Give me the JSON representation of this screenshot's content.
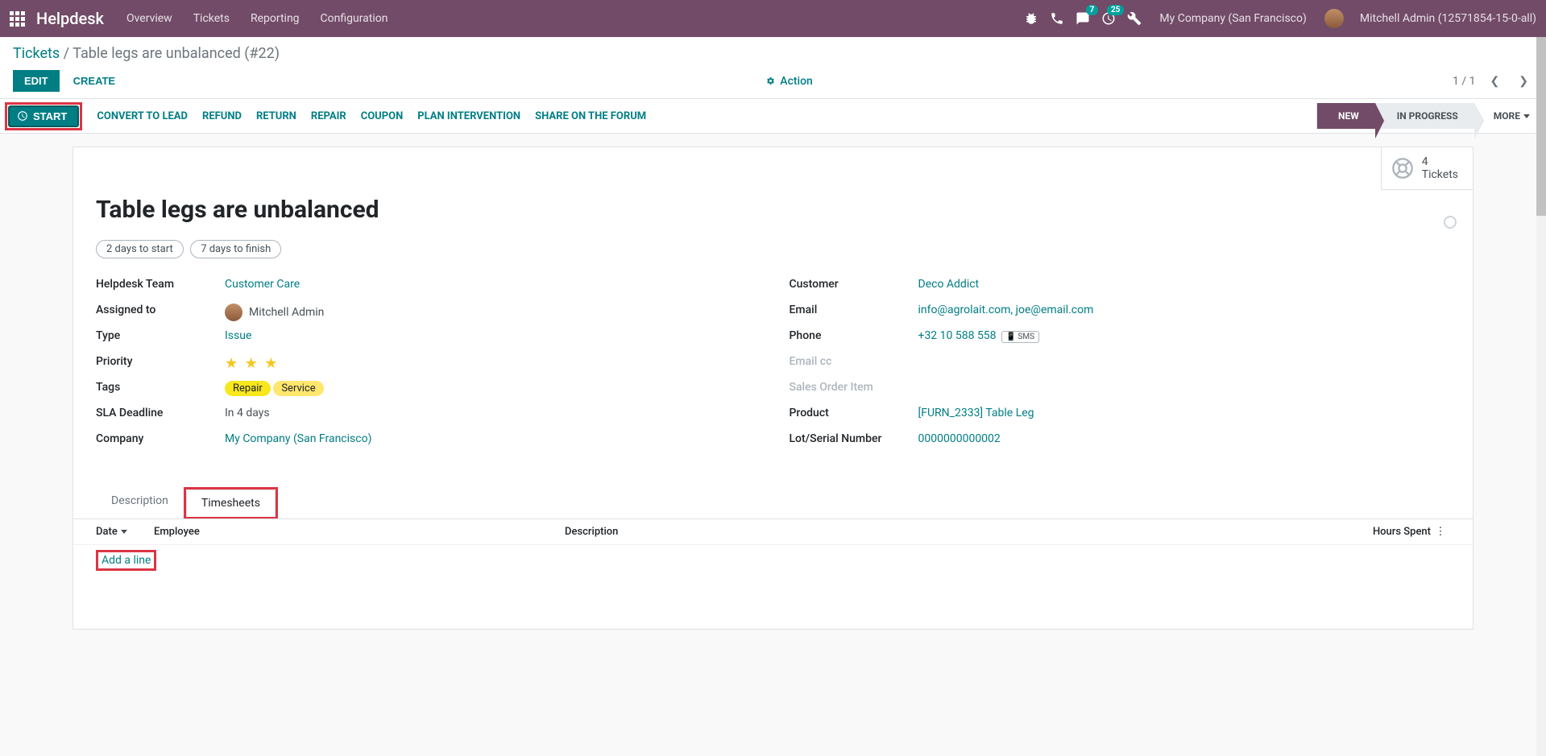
{
  "topbar": {
    "brand": "Helpdesk",
    "nav": [
      "Overview",
      "Tickets",
      "Reporting",
      "Configuration"
    ],
    "msg_badge": "7",
    "activity_badge": "25",
    "company": "My Company (San Francisco)",
    "user": "Mitchell Admin (12571854-15-0-all)"
  },
  "breadcrumb": {
    "root": "Tickets",
    "sep": " / ",
    "current": "Table legs are unbalanced (#22)"
  },
  "controls": {
    "edit": "EDIT",
    "create": "CREATE",
    "action": "Action",
    "pager": "1 / 1"
  },
  "statusbar": {
    "start": "START",
    "actions": [
      "CONVERT TO LEAD",
      "REFUND",
      "RETURN",
      "REPAIR",
      "COUPON",
      "PLAN INTERVENTION",
      "SHARE ON THE FORUM"
    ],
    "stages": {
      "new": "NEW",
      "in_progress": "IN PROGRESS",
      "more": "MORE"
    }
  },
  "stat": {
    "count": "4",
    "label": "Tickets"
  },
  "record": {
    "title": "Table legs are unbalanced",
    "sla1": "2 days to start",
    "sla2": "7 days to finish",
    "labels": {
      "helpdesk_team": "Helpdesk Team",
      "assigned_to": "Assigned to",
      "type": "Type",
      "priority": "Priority",
      "tags": "Tags",
      "sla_deadline": "SLA Deadline",
      "company": "Company",
      "customer": "Customer",
      "email": "Email",
      "phone": "Phone",
      "email_cc": "Email cc",
      "sales_order_item": "Sales Order Item",
      "product": "Product",
      "lot_serial": "Lot/Serial Number"
    },
    "values": {
      "helpdesk_team": "Customer Care",
      "assigned_to": "Mitchell Admin",
      "type": "Issue",
      "tag1": "Repair",
      "tag2": "Service",
      "sla_deadline": "In 4 days",
      "company": "My Company (San Francisco)",
      "customer": "Deco Addict",
      "email": "info@agrolait.com, joe@email.com",
      "phone": "+32 10 588 558",
      "sms": "SMS",
      "product": "[FURN_2333] Table Leg",
      "lot_serial": "0000000000002"
    }
  },
  "tabs": {
    "description": "Description",
    "timesheets": "Timesheets"
  },
  "timesheet": {
    "columns": {
      "date": "Date",
      "employee": "Employee",
      "description": "Description",
      "hours": "Hours Spent"
    },
    "add_line": "Add a line"
  }
}
